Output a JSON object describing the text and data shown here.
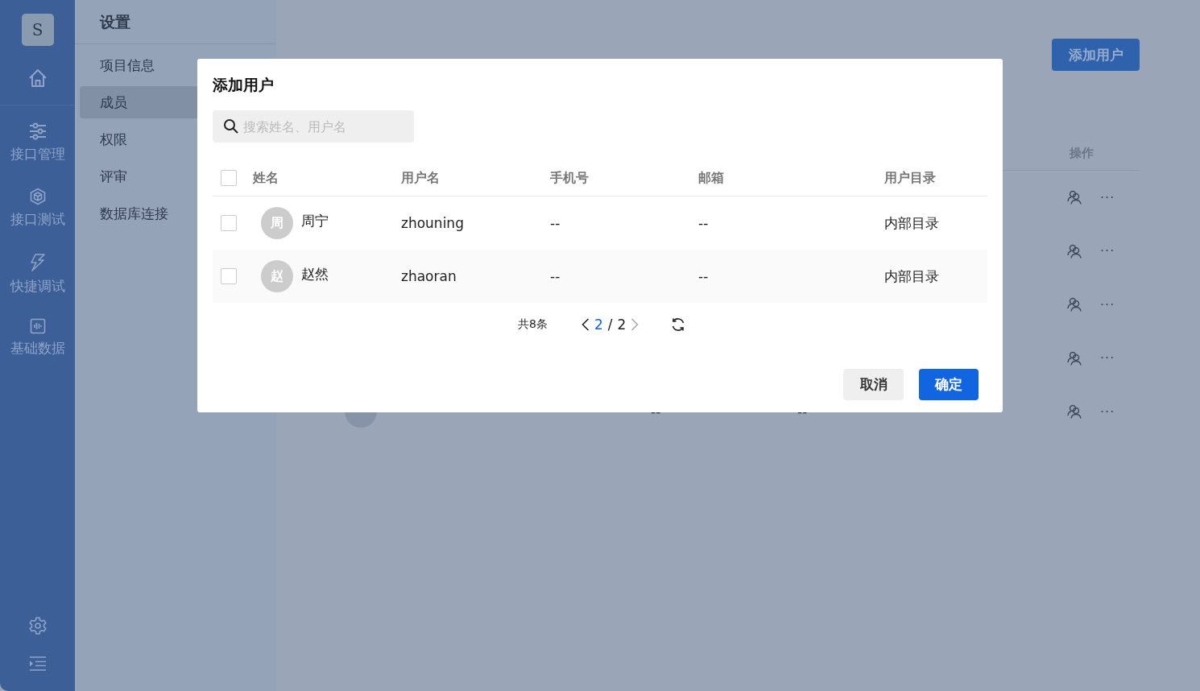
{
  "sidebar": {
    "logo": "S",
    "items": [
      {
        "label": "接口管理"
      },
      {
        "label": "接口测试"
      },
      {
        "label": "快捷调试"
      },
      {
        "label": "基础数据"
      }
    ]
  },
  "settings": {
    "title": "设置",
    "items": [
      {
        "label": "项目信息",
        "selected": false
      },
      {
        "label": "成员",
        "selected": true
      },
      {
        "label": "权限",
        "selected": false
      },
      {
        "label": "评审",
        "selected": false
      },
      {
        "label": "数据库连接",
        "selected": false
      }
    ]
  },
  "members": {
    "add_button": "添加用户",
    "action_header": "操作",
    "rows": [
      {
        "more": "···"
      },
      {
        "more": "···"
      },
      {
        "more": "···"
      },
      {
        "more": "···"
      },
      {
        "avatar": true,
        "phone": "--",
        "email": "--",
        "more": "···"
      }
    ]
  },
  "dialog": {
    "title": "添加用户",
    "search": {
      "placeholder": "搜索姓名、用户名"
    },
    "select_all_checked": false,
    "columns": [
      "姓名",
      "用户名",
      "手机号",
      "邮箱",
      "用户目录"
    ],
    "rows": [
      {
        "selected": false,
        "avatar": "周",
        "name": "周宁",
        "username": "zhouning",
        "phone": "--",
        "email": "--",
        "directory": "内部目录"
      },
      {
        "selected": false,
        "avatar": "赵",
        "name": "赵然",
        "username": "zhaoran",
        "phone": "--",
        "email": "--",
        "directory": "内部目录"
      }
    ],
    "pagination": {
      "total": "共8条",
      "current": "2",
      "separator": "/",
      "pages": "2",
      "prev_disabled": false,
      "next_disabled": true
    },
    "cancel": "取消",
    "confirm": "确定"
  }
}
